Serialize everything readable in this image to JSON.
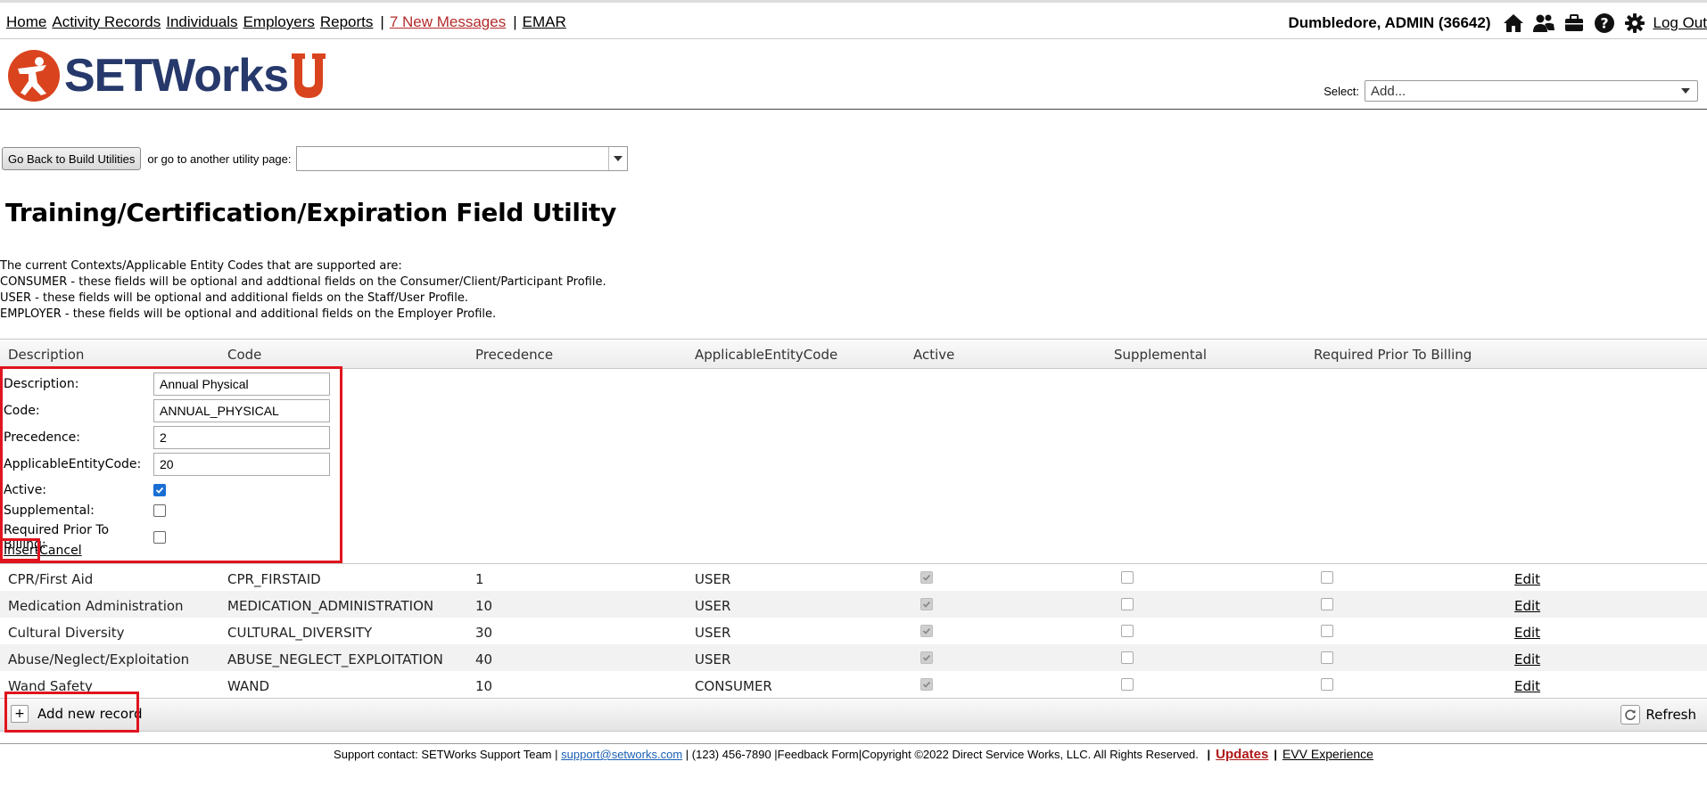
{
  "nav": {
    "home": "Home",
    "activity_records": "Activity Records",
    "individuals": "Individuals",
    "employers": "Employers",
    "reports": "Reports",
    "messages": "7 New Messages",
    "emar": "EMAR",
    "sep": "|"
  },
  "user": {
    "name": "Dumbledore, ADMIN  (36642)",
    "logout": "Log Out",
    "icons": [
      "home-icon",
      "users-icon",
      "briefcase-icon",
      "help-icon",
      "settings-icon"
    ]
  },
  "brand": {
    "logo_text": "SETWorks",
    "accent": "#d9441e",
    "navy": "#27396b"
  },
  "header_select": {
    "label": "Select:",
    "value": "Add..."
  },
  "utility": {
    "back_button": "Go Back to Build Utilities",
    "text": "or go to another utility page:",
    "selected": ""
  },
  "page_title": "Training/Certification/Expiration Field Utility",
  "intro": {
    "line1": "The current Contexts/Applicable Entity Codes that are supported are:",
    "line2": "CONSUMER - these fields will be optional and addtional fields on the Consumer/Client/Participant Profile.",
    "line3": "USER - these fields will be optional and additional fields on the Staff/User Profile.",
    "line4": "EMPLOYER - these fields will be optional and additional fields on the Employer Profile."
  },
  "grid": {
    "columns": [
      "Description",
      "Code",
      "Precedence",
      "ApplicableEntityCode",
      "Active",
      "Supplemental",
      "Required Prior To Billing"
    ],
    "form": {
      "description_label": "Description:",
      "description_value": "Annual Physical",
      "code_label": "Code:",
      "code_value": "ANNUAL_PHYSICAL",
      "precedence_label": "Precedence:",
      "precedence_value": "2",
      "entity_label": "ApplicableEntityCode:",
      "entity_value": "20",
      "active_label": "Active:",
      "active_checked": true,
      "supplemental_label": "Supplemental:",
      "supplemental_checked": false,
      "billing_label": "Required Prior To Billing:",
      "billing_checked": false,
      "insert": "Insert",
      "cancel": "Cancel"
    },
    "rows": [
      {
        "description": "CPR/First Aid",
        "code": "CPR_FIRSTAID",
        "precedence": "1",
        "entity": "USER",
        "active": true,
        "supplemental": false,
        "billing": false,
        "edit": "Edit"
      },
      {
        "description": "Medication Administration",
        "code": "MEDICATION_ADMINISTRATION",
        "precedence": "10",
        "entity": "USER",
        "active": true,
        "supplemental": false,
        "billing": false,
        "edit": "Edit"
      },
      {
        "description": "Cultural Diversity",
        "code": "CULTURAL_DIVERSITY",
        "precedence": "30",
        "entity": "USER",
        "active": true,
        "supplemental": false,
        "billing": false,
        "edit": "Edit"
      },
      {
        "description": "Abuse/Neglect/Exploitation",
        "code": "ABUSE_NEGLECT_EXPLOITATION",
        "precedence": "40",
        "entity": "USER",
        "active": true,
        "supplemental": false,
        "billing": false,
        "edit": "Edit"
      },
      {
        "description": "Wand Safety",
        "code": "WAND",
        "precedence": "10",
        "entity": "CONSUMER",
        "active": true,
        "supplemental": false,
        "billing": false,
        "edit": "Edit"
      }
    ],
    "add_new": "Add new record",
    "refresh": "Refresh"
  },
  "footer": {
    "support": "Support contact: SETWorks Support Team |",
    "email": "support@setworks.com",
    "rest": "| (123) 456-7890 |Feedback Form|Copyright ©2022 Direct Service Works, LLC. All Rights Reserved.",
    "bar": "|",
    "updates": "Updates",
    "evv": "EVV Experience"
  },
  "highlight_color": "#e0141e"
}
